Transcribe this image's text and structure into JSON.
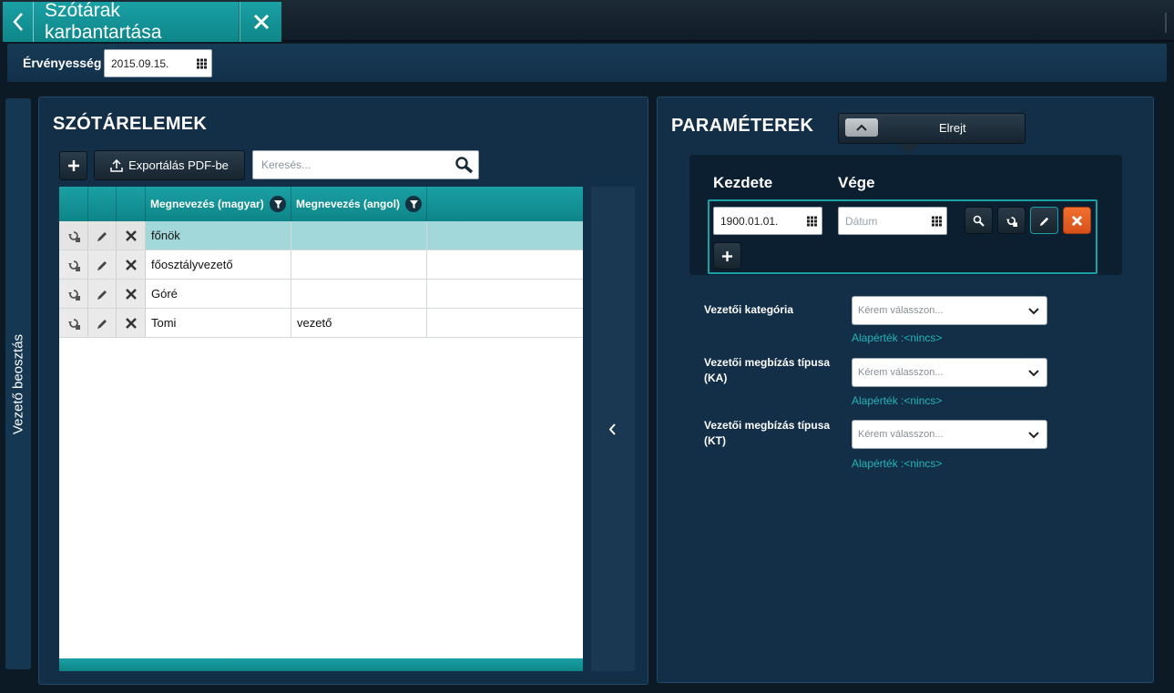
{
  "header": {
    "title": "Szótárak karbantartása"
  },
  "validity": {
    "label": "Érvényesség",
    "date": "2015.09.15."
  },
  "side_tab": {
    "label": "Vezető beosztás"
  },
  "left_panel": {
    "title": "SZÓTÁRELEMEK",
    "export_label": "Exportálás PDF-be",
    "search_placeholder": "Keresés...",
    "columns": [
      "Megnevezés (magyar)",
      "Megnevezés (angol)"
    ],
    "rows": [
      {
        "hu": "főnök",
        "en": "",
        "selected": true
      },
      {
        "hu": "főosztályvezető",
        "en": "",
        "selected": false
      },
      {
        "hu": "Góré",
        "en": "",
        "selected": false
      },
      {
        "hu": "Tomi",
        "en": "vezető",
        "selected": false
      }
    ]
  },
  "right_panel": {
    "title": "PARAMÉTEREK",
    "hide_label": "Elrejt",
    "period": {
      "start_label": "Kezdete",
      "end_label": "Vége",
      "start_value": "1900.01.01.",
      "end_placeholder": "Dátum"
    },
    "params": [
      {
        "label_line1": "Vezetői kategória",
        "label_line2": "",
        "placeholder": "Kérem válasszon...",
        "default": "Alapérték :<nincs>"
      },
      {
        "label_line1": "Vezetői megbízás típusa",
        "label_line2": "(KA)",
        "placeholder": "Kérem válasszon...",
        "default": "Alapérték :<nincs>"
      },
      {
        "label_line1": "Vezetői megbízás típusa",
        "label_line2": "(KT)",
        "placeholder": "Kérem válasszon...",
        "default": "Alapérték :<nincs>"
      }
    ]
  },
  "colors": {
    "accent": "#1aa0a4",
    "panel": "#132f48",
    "selected_row": "#a2d8da",
    "danger": "#e8602a",
    "default_text": "#1fb5b9"
  },
  "icons": {
    "back": "chevron-left-icon",
    "close": "close-icon",
    "calendar": "calendar-icon",
    "add": "plus-icon",
    "export": "upload-icon",
    "search": "search-icon",
    "filter": "filter-icon",
    "history": "history-icon",
    "edit": "pencil-icon",
    "delete": "delete-icon",
    "collapse": "chevron-left-icon",
    "hide": "chevron-up-icon",
    "dropdown": "chevron-down-icon"
  }
}
